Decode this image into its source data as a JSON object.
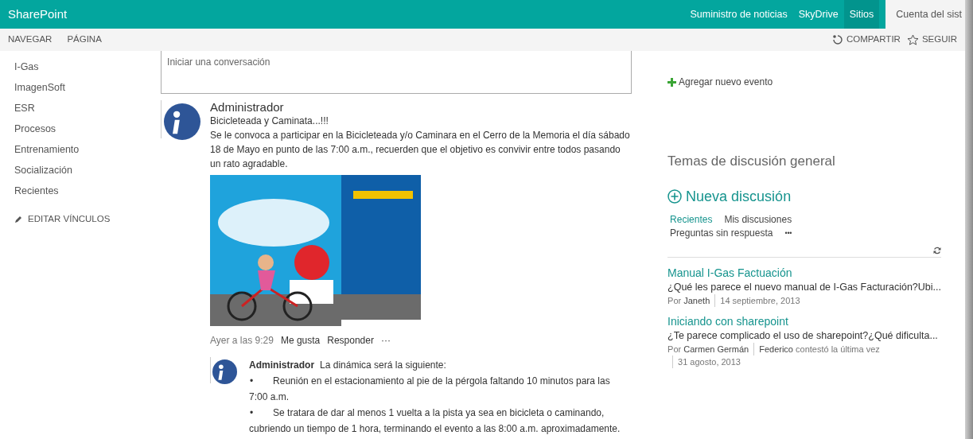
{
  "top_bar": {
    "brand": "SharePoint",
    "links": [
      {
        "label": "Suministro de noticias",
        "selected": false
      },
      {
        "label": "SkyDrive",
        "selected": false
      },
      {
        "label": "Sitios",
        "selected": true
      }
    ],
    "account": "Cuenta del sist"
  },
  "ribbon": {
    "tabs": [
      "NAVEGAR",
      "PÁGINA"
    ],
    "actions": [
      {
        "kind": "share",
        "label": "COMPARTIR"
      },
      {
        "kind": "follow",
        "label": "SEGUIR"
      }
    ]
  },
  "sidebar": {
    "items": [
      "I-Gas",
      "ImagenSoft",
      "ESR",
      "Procesos",
      "Entrenamiento",
      "Socialización",
      "Recientes"
    ],
    "edit_links": "EDITAR VÍNCULOS"
  },
  "newsfeed": {
    "compose_placeholder": "Iniciar una conversación",
    "post": {
      "author": "Administrador",
      "title": "Bicicleteada y Caminata...!!!",
      "body": "Se le convoca a participar en la Bicicleteada y/o Caminara en el Cerro de la Memoria el día sábado 18 de Mayo en punto de las 7:00 a.m., recuerden que el objetivo es convivir entre todos pasando un rato agradable.",
      "time": "Ayer a las 9:29",
      "actions": [
        "Me gusta",
        "Responder",
        "···"
      ],
      "reply": {
        "author": "Administrador",
        "intro": "La dinámica será la siguiente:",
        "bullets": [
          {
            "marker": "•",
            "text": "Reunión en el estacionamiento al pie de la pérgola faltando 10 minutos para las 7:00 a.m."
          },
          {
            "marker": "•",
            "text": "Se tratara de dar al menos 1 vuelta a la pista ya sea en bicicleta o caminando, cubriendo un tiempo de 1 hora, terminando el evento a las 8:00 a.m. aproximadamente."
          }
        ]
      }
    }
  },
  "events": {
    "add_event": "Agregar nuevo evento"
  },
  "discussions": {
    "title": "Temas de discusión general",
    "new_discussion": "Nueva discusión",
    "filters": [
      {
        "label": "Recientes",
        "selected": true
      },
      {
        "label": "Mis discusiones",
        "selected": false
      },
      {
        "label": "Preguntas sin respuesta",
        "selected": false
      }
    ],
    "more": "•••",
    "topics": [
      {
        "title": "Manual I-Gas Factuación",
        "excerpt": "¿Qué les parece el nuevo manual de I-Gas Facturación?Ubi...",
        "meta": [
          [
            "Por ",
            "Janeth"
          ],
          [
            "14 septiembre, 2013"
          ]
        ]
      },
      {
        "title": "Iniciando con sharepoint",
        "excerpt": "¿Te parece complicado el uso de sharepoint?¿Qué dificulta...",
        "meta": [
          [
            "Por ",
            "Carmen Germán"
          ],
          [
            "Federico",
            " contestó la última vez"
          ],
          [
            "31 agosto, 2013"
          ]
        ]
      }
    ]
  }
}
